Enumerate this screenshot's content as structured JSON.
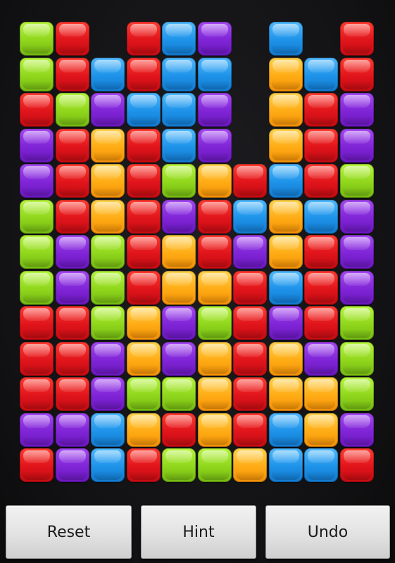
{
  "board": {
    "rows": [
      [
        "green",
        "red",
        null,
        "red",
        "blue",
        "purple",
        null,
        "blue",
        null,
        "red"
      ],
      [
        "green",
        "red",
        "blue",
        "red",
        "blue",
        "blue",
        null,
        "orange",
        "blue",
        "red"
      ],
      [
        "red",
        "green",
        "purple",
        "blue",
        "blue",
        "purple",
        null,
        "orange",
        "red",
        "purple"
      ],
      [
        "purple",
        "red",
        "orange",
        "red",
        "blue",
        "purple",
        null,
        "orange",
        "red",
        "purple"
      ],
      [
        "purple",
        "red",
        "orange",
        "red",
        "green",
        "orange",
        "red",
        "blue",
        "red",
        "green"
      ],
      [
        "green",
        "red",
        "orange",
        "red",
        "purple",
        "red",
        "blue",
        "orange",
        "blue",
        "purple"
      ],
      [
        "green",
        "purple",
        "green",
        "red",
        "orange",
        "red",
        "purple",
        "orange",
        "red",
        "purple"
      ],
      [
        "green",
        "purple",
        "green",
        "red",
        "orange",
        "orange",
        "red",
        "blue",
        "red",
        "purple"
      ],
      [
        "red",
        "red",
        "green",
        "orange",
        "purple",
        "green",
        "red",
        "purple",
        "red",
        "green"
      ],
      [
        "red",
        "red",
        "purple",
        "orange",
        "purple",
        "orange",
        "red",
        "orange",
        "purple",
        "green"
      ],
      [
        "red",
        "red",
        "purple",
        "green",
        "green",
        "orange",
        "red",
        "orange",
        "orange",
        "green"
      ],
      [
        "purple",
        "purple",
        "blue",
        "orange",
        "red",
        "orange",
        "red",
        "blue",
        "orange",
        "purple"
      ],
      [
        "red",
        "purple",
        "blue",
        "red",
        "green",
        "green",
        "orange",
        "blue",
        "blue",
        "red"
      ]
    ]
  },
  "buttons": {
    "reset_label": "Reset",
    "hint_label": "Hint",
    "undo_label": "Undo"
  },
  "colors": {
    "red": "#e0141b",
    "green": "#8fd61c",
    "blue": "#1d92e8",
    "purple": "#7f24d6",
    "orange": "#ffab14",
    "background": "#121214"
  }
}
